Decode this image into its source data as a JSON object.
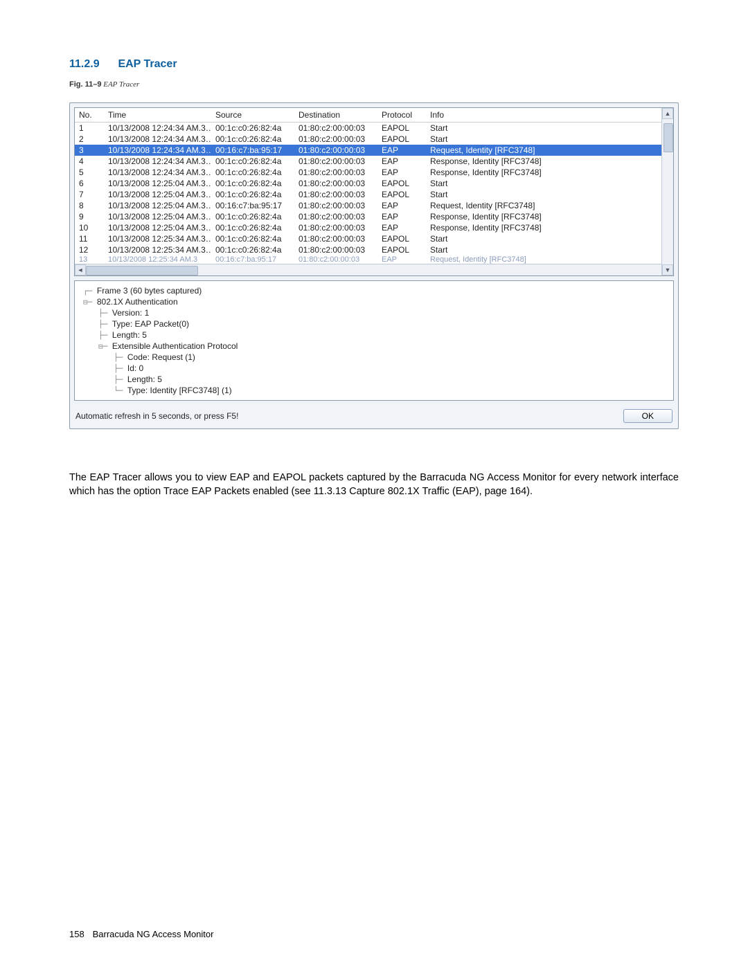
{
  "heading": {
    "number": "11.2.9",
    "title": "EAP Tracer"
  },
  "figure_caption": {
    "label": "Fig. 11–9",
    "text": "EAP Tracer"
  },
  "columns": [
    "No.",
    "Time",
    "Source",
    "Destination",
    "Protocol",
    "Info"
  ],
  "rows": [
    {
      "no": "1",
      "time": "10/13/2008 12:24:34 AM.3…",
      "src": "00:1c:c0:26:82:4a",
      "dst": "01:80:c2:00:00:03",
      "proto": "EAPOL",
      "info": "Start",
      "selected": false
    },
    {
      "no": "2",
      "time": "10/13/2008 12:24:34 AM.3…",
      "src": "00:1c:c0:26:82:4a",
      "dst": "01:80:c2:00:00:03",
      "proto": "EAPOL",
      "info": "Start",
      "selected": false
    },
    {
      "no": "3",
      "time": "10/13/2008 12:24:34 AM.3…",
      "src": "00:16:c7:ba:95:17",
      "dst": "01:80:c2:00:00:03",
      "proto": "EAP",
      "info": "Request, Identity [RFC3748]",
      "selected": true
    },
    {
      "no": "4",
      "time": "10/13/2008 12:24:34 AM.3…",
      "src": "00:1c:c0:26:82:4a",
      "dst": "01:80:c2:00:00:03",
      "proto": "EAP",
      "info": "Response, Identity [RFC3748]",
      "selected": false
    },
    {
      "no": "5",
      "time": "10/13/2008 12:24:34 AM.3…",
      "src": "00:1c:c0:26:82:4a",
      "dst": "01:80:c2:00:00:03",
      "proto": "EAP",
      "info": "Response, Identity [RFC3748]",
      "selected": false
    },
    {
      "no": "6",
      "time": "10/13/2008 12:25:04 AM.3…",
      "src": "00:1c:c0:26:82:4a",
      "dst": "01:80:c2:00:00:03",
      "proto": "EAPOL",
      "info": "Start",
      "selected": false
    },
    {
      "no": "7",
      "time": "10/13/2008 12:25:04 AM.3…",
      "src": "00:1c:c0:26:82:4a",
      "dst": "01:80:c2:00:00:03",
      "proto": "EAPOL",
      "info": "Start",
      "selected": false
    },
    {
      "no": "8",
      "time": "10/13/2008 12:25:04 AM.3…",
      "src": "00:16:c7:ba:95:17",
      "dst": "01:80:c2:00:00:03",
      "proto": "EAP",
      "info": "Request, Identity [RFC3748]",
      "selected": false
    },
    {
      "no": "9",
      "time": "10/13/2008 12:25:04 AM.3…",
      "src": "00:1c:c0:26:82:4a",
      "dst": "01:80:c2:00:00:03",
      "proto": "EAP",
      "info": "Response, Identity [RFC3748]",
      "selected": false
    },
    {
      "no": "10",
      "time": "10/13/2008 12:25:04 AM.3…",
      "src": "00:1c:c0:26:82:4a",
      "dst": "01:80:c2:00:00:03",
      "proto": "EAP",
      "info": "Response, Identity [RFC3748]",
      "selected": false
    },
    {
      "no": "11",
      "time": "10/13/2008 12:25:34 AM.3…",
      "src": "00:1c:c0:26:82:4a",
      "dst": "01:80:c2:00:00:03",
      "proto": "EAPOL",
      "info": "Start",
      "selected": false
    },
    {
      "no": "12",
      "time": "10/13/2008 12:25:34 AM.3…",
      "src": "00:1c:c0:26:82:4a",
      "dst": "01:80:c2:00:00:03",
      "proto": "EAPOL",
      "info": "Start",
      "selected": false
    }
  ],
  "partial_row": {
    "no": "13",
    "time": "10/13/2008 12:25:34 AM.3",
    "src": "00:16:c7:ba:95:17",
    "dst": "01:80:c2:00:00:03",
    "proto": "EAP",
    "info": "Request, Identity [RFC3748]"
  },
  "tree": [
    {
      "indent": 0,
      "glyph": "┌─",
      "text": "Frame 3 (60 bytes captured)"
    },
    {
      "indent": 0,
      "glyph": "⊟─",
      "text": "802.1X Authentication"
    },
    {
      "indent": 1,
      "glyph": "├─",
      "text": "Version: 1"
    },
    {
      "indent": 1,
      "glyph": "├─",
      "text": "Type: EAP Packet(0)"
    },
    {
      "indent": 1,
      "glyph": "├─",
      "text": "Length: 5"
    },
    {
      "indent": 1,
      "glyph": "⊟─",
      "text": "Extensible Authentication Protocol"
    },
    {
      "indent": 2,
      "glyph": "├─",
      "text": "Code: Request (1)"
    },
    {
      "indent": 2,
      "glyph": "├─",
      "text": "Id: 0"
    },
    {
      "indent": 2,
      "glyph": "├─",
      "text": "Length: 5"
    },
    {
      "indent": 2,
      "glyph": "└─",
      "text": "Type: Identity [RFC3748] (1)"
    }
  ],
  "status_text": "Automatic refresh in 5 seconds, or press F5!",
  "ok_label": "OK",
  "body_text": "The EAP Tracer allows you to view EAP and EAPOL packets captured by the Barracuda NG Access Monitor for every network interface which has the option Trace EAP Packets enabled (see 11.3.13 Capture 802.1X Traffic (EAP), page 164).",
  "footer": {
    "page": "158",
    "title": "Barracuda NG Access Monitor"
  }
}
